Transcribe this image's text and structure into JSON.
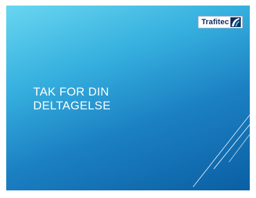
{
  "slide": {
    "logo_text": "Trafitec",
    "title_line1": "TAK FOR DIN",
    "title_line2": "DELTAGELSE"
  },
  "colors": {
    "gradient_light": "#69d6f0",
    "gradient_dark": "#0b5fa3",
    "logo_text": "#0c2e63",
    "title_text": "#ffffff"
  },
  "icons": {
    "logo_mark": "trafitec-swoosh-icon"
  }
}
